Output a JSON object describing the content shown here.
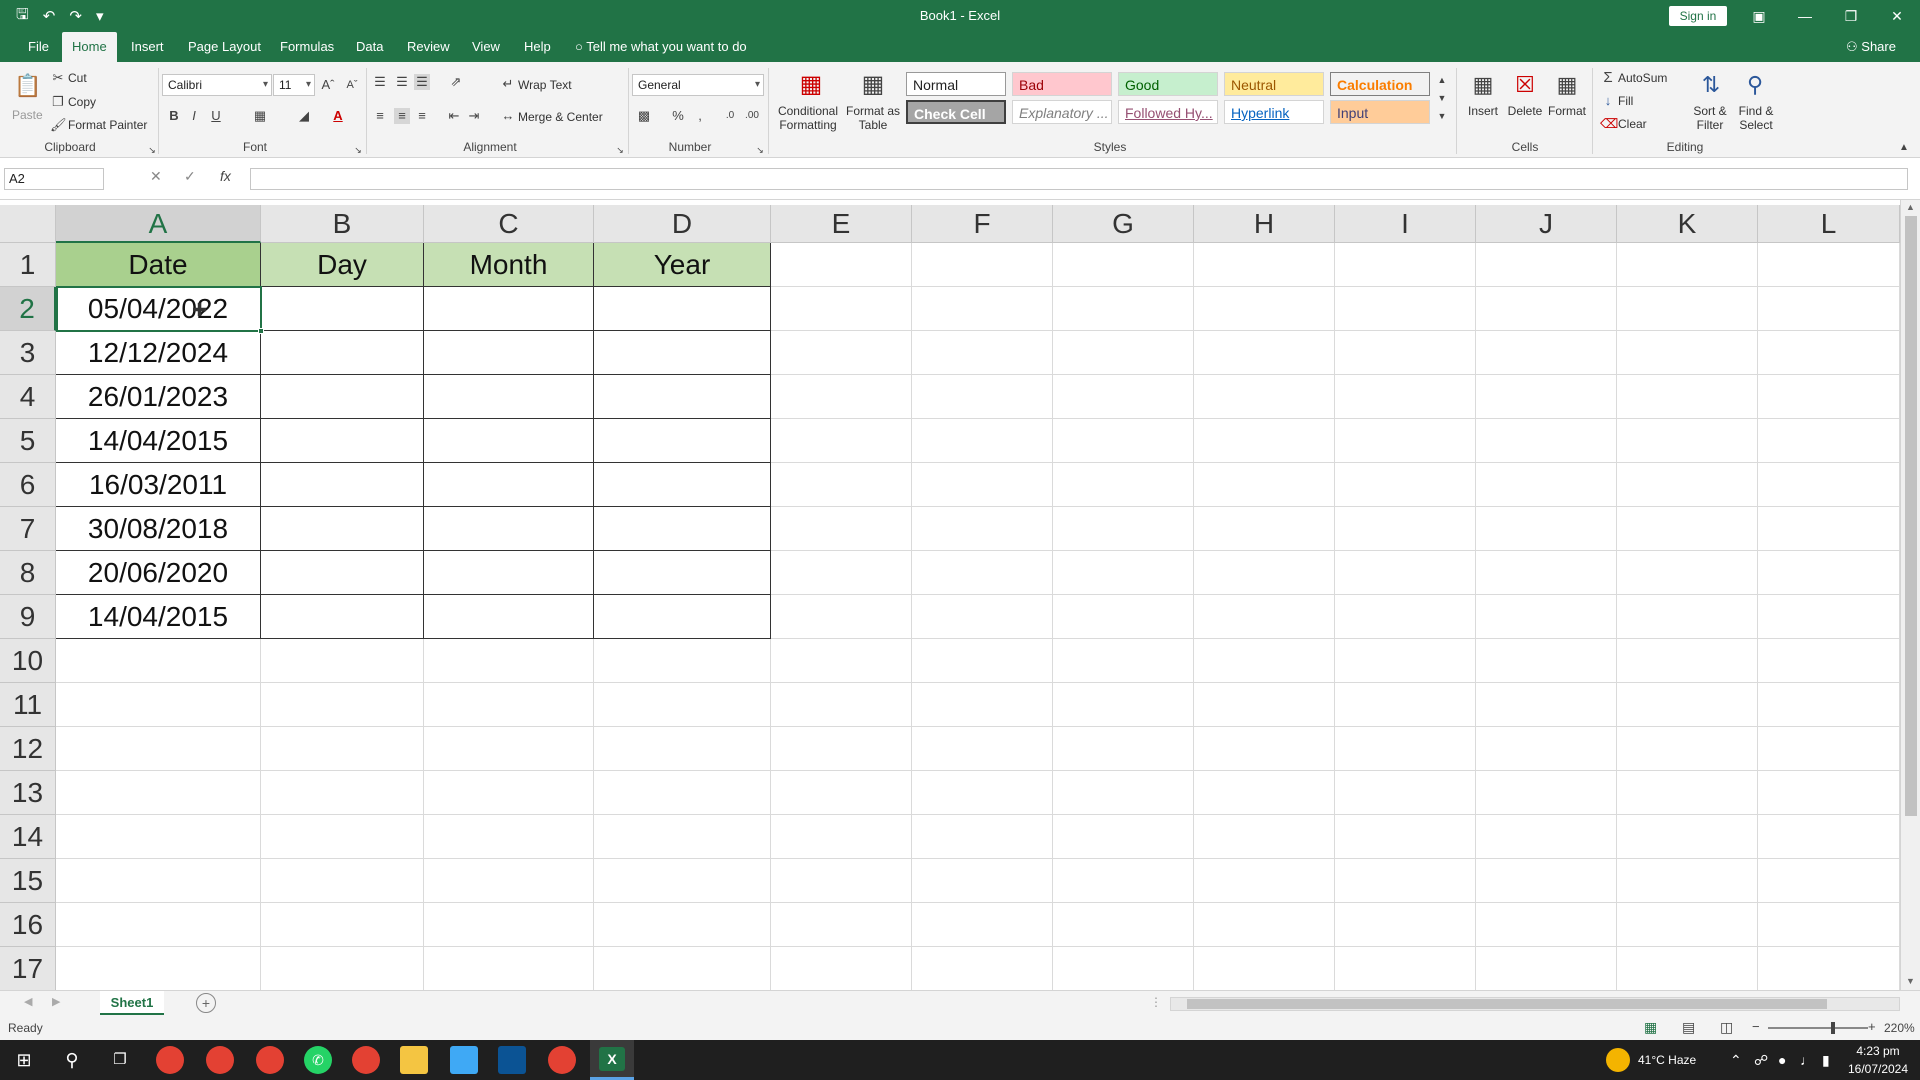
{
  "window": {
    "title": "Book1 - Excel",
    "sign_in": "Sign in"
  },
  "ribbon_tabs": [
    "File",
    "Home",
    "Insert",
    "Page Layout",
    "Formulas",
    "Data",
    "Review",
    "View",
    "Help"
  ],
  "tell_me": "Tell me what you want to do",
  "share": "Share",
  "clipboard": {
    "paste": "Paste",
    "cut": "Cut",
    "copy": "Copy",
    "format_painter": "Format Painter",
    "label": "Clipboard"
  },
  "font": {
    "family": "Calibri",
    "size": "11",
    "label": "Font"
  },
  "alignment": {
    "wrap_text": "Wrap Text",
    "merge_center": "Merge & Center",
    "label": "Alignment"
  },
  "number": {
    "format": "General",
    "label": "Number"
  },
  "styles": {
    "conditional": "Conditional Formatting",
    "format_as_table": "Format as Table",
    "normal": "Normal",
    "bad": "Bad",
    "good": "Good",
    "neutral": "Neutral",
    "calculation": "Calculation",
    "check_cell": "Check Cell",
    "explanatory": "Explanatory ...",
    "followed": "Followed Hy...",
    "hyperlink": "Hyperlink",
    "input": "Input",
    "label": "Styles"
  },
  "cells": {
    "insert": "Insert",
    "delete": "Delete",
    "format": "Format",
    "label": "Cells"
  },
  "editing": {
    "autosum": "AutoSum",
    "fill": "Fill",
    "clear": "Clear",
    "sort_filter": "Sort & Filter",
    "find_select": "Find & Select",
    "label": "Editing"
  },
  "formula_bar": {
    "name_box": "A2",
    "fx": "fx",
    "value": ""
  },
  "columns": [
    "A",
    "B",
    "C",
    "D",
    "E",
    "F",
    "G",
    "H",
    "I",
    "J",
    "K",
    "L"
  ],
  "rows": [
    "1",
    "2",
    "3",
    "4",
    "5",
    "6",
    "7",
    "8",
    "9",
    "10",
    "11",
    "12",
    "13",
    "14",
    "15",
    "16",
    "17"
  ],
  "table": {
    "headers": [
      "Date",
      "Day",
      "Month",
      "Year"
    ],
    "dates": [
      "05/04/2022",
      "12/12/2024",
      "26/01/2023",
      "14/04/2015",
      "16/03/2011",
      "30/08/2018",
      "20/06/2020",
      "14/04/2015"
    ]
  },
  "sheet": {
    "tab": "Sheet1"
  },
  "status": {
    "ready": "Ready",
    "zoom": "220%"
  },
  "taskbar": {
    "weather": "41°C Haze",
    "time": "4:23 pm",
    "date": "16/07/2024"
  }
}
